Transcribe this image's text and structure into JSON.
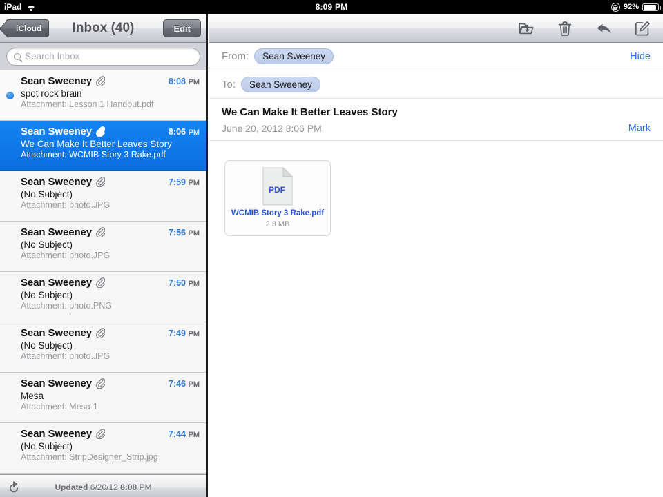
{
  "status_bar": {
    "device": "iPad",
    "wifi_icon": "wifi-icon",
    "time": "8:09 PM",
    "rotation_lock_icon": "rotation-lock-icon",
    "battery_percent": "92%",
    "battery_icon": "battery-icon",
    "battery_level": 92
  },
  "mailbox": {
    "back_label": "iCloud",
    "title": "Inbox (40)",
    "edit_label": "Edit",
    "unread_count": 40,
    "search": {
      "placeholder": "Search Inbox",
      "value": "",
      "icon": "search-icon"
    },
    "footer": {
      "refresh_icon": "refresh-icon",
      "updated_label": "Updated",
      "updated_date": "6/20/12",
      "updated_time": "8:08",
      "updated_ampm": "PM"
    },
    "messages": [
      {
        "sender": "Sean Sweeney",
        "clip_icon": "paperclip-icon",
        "time": "8:08",
        "ampm": "PM",
        "subject": "spot rock brain",
        "attachment": "Attachment: Lesson 1 Handout.pdf",
        "unread": true,
        "selected": false
      },
      {
        "sender": "Sean Sweeney",
        "clip_icon": "paperclip-icon",
        "time": "8:06",
        "ampm": "PM",
        "subject": "We Can Make It Better Leaves Story",
        "attachment": "Attachment: WCMIB Story 3 Rake.pdf",
        "unread": false,
        "selected": true
      },
      {
        "sender": "Sean Sweeney",
        "clip_icon": "paperclip-icon",
        "time": "7:59",
        "ampm": "PM",
        "subject": "(No Subject)",
        "attachment": "Attachment: photo.JPG",
        "unread": false,
        "selected": false
      },
      {
        "sender": "Sean Sweeney",
        "clip_icon": "paperclip-icon",
        "time": "7:56",
        "ampm": "PM",
        "subject": "(No Subject)",
        "attachment": "Attachment: photo.JPG",
        "unread": false,
        "selected": false
      },
      {
        "sender": "Sean Sweeney",
        "clip_icon": "paperclip-icon",
        "time": "7:50",
        "ampm": "PM",
        "subject": "(No Subject)",
        "attachment": "Attachment: photo.PNG",
        "unread": false,
        "selected": false
      },
      {
        "sender": "Sean Sweeney",
        "clip_icon": "paperclip-icon",
        "time": "7:49",
        "ampm": "PM",
        "subject": "(No Subject)",
        "attachment": "Attachment: photo.JPG",
        "unread": false,
        "selected": false
      },
      {
        "sender": "Sean Sweeney",
        "clip_icon": "paperclip-icon",
        "time": "7:46",
        "ampm": "PM",
        "subject": "Mesa",
        "attachment": "Attachment: Mesa-1",
        "unread": false,
        "selected": false
      },
      {
        "sender": "Sean Sweeney",
        "clip_icon": "paperclip-icon",
        "time": "7:44",
        "ampm": "PM",
        "subject": "(No Subject)",
        "attachment": "Attachment: StripDesigner_Strip.jpg",
        "unread": false,
        "selected": false
      }
    ]
  },
  "message": {
    "toolbar_icons": [
      "move-to-folder-icon",
      "trash-icon",
      "reply-icon",
      "compose-icon"
    ],
    "from_label": "From:",
    "from_value": "Sean Sweeney",
    "hide_label": "Hide",
    "to_label": "To:",
    "to_value": "Sean Sweeney",
    "subject": "We Can Make It Better Leaves Story",
    "date": "June 20, 2012 8:06 PM",
    "mark_label": "Mark",
    "attachment": {
      "type_label": "PDF",
      "name": "WCMIB Story 3 Rake.pdf",
      "size": "2.3 MB",
      "icon": "pdf-file-icon"
    }
  },
  "colors": {
    "selection_blue": "#1583f2",
    "link_blue": "#2b6eeb",
    "time_blue": "#2f77d6",
    "attachment_link": "#2b55d8",
    "statusbar_black": "#000000"
  }
}
